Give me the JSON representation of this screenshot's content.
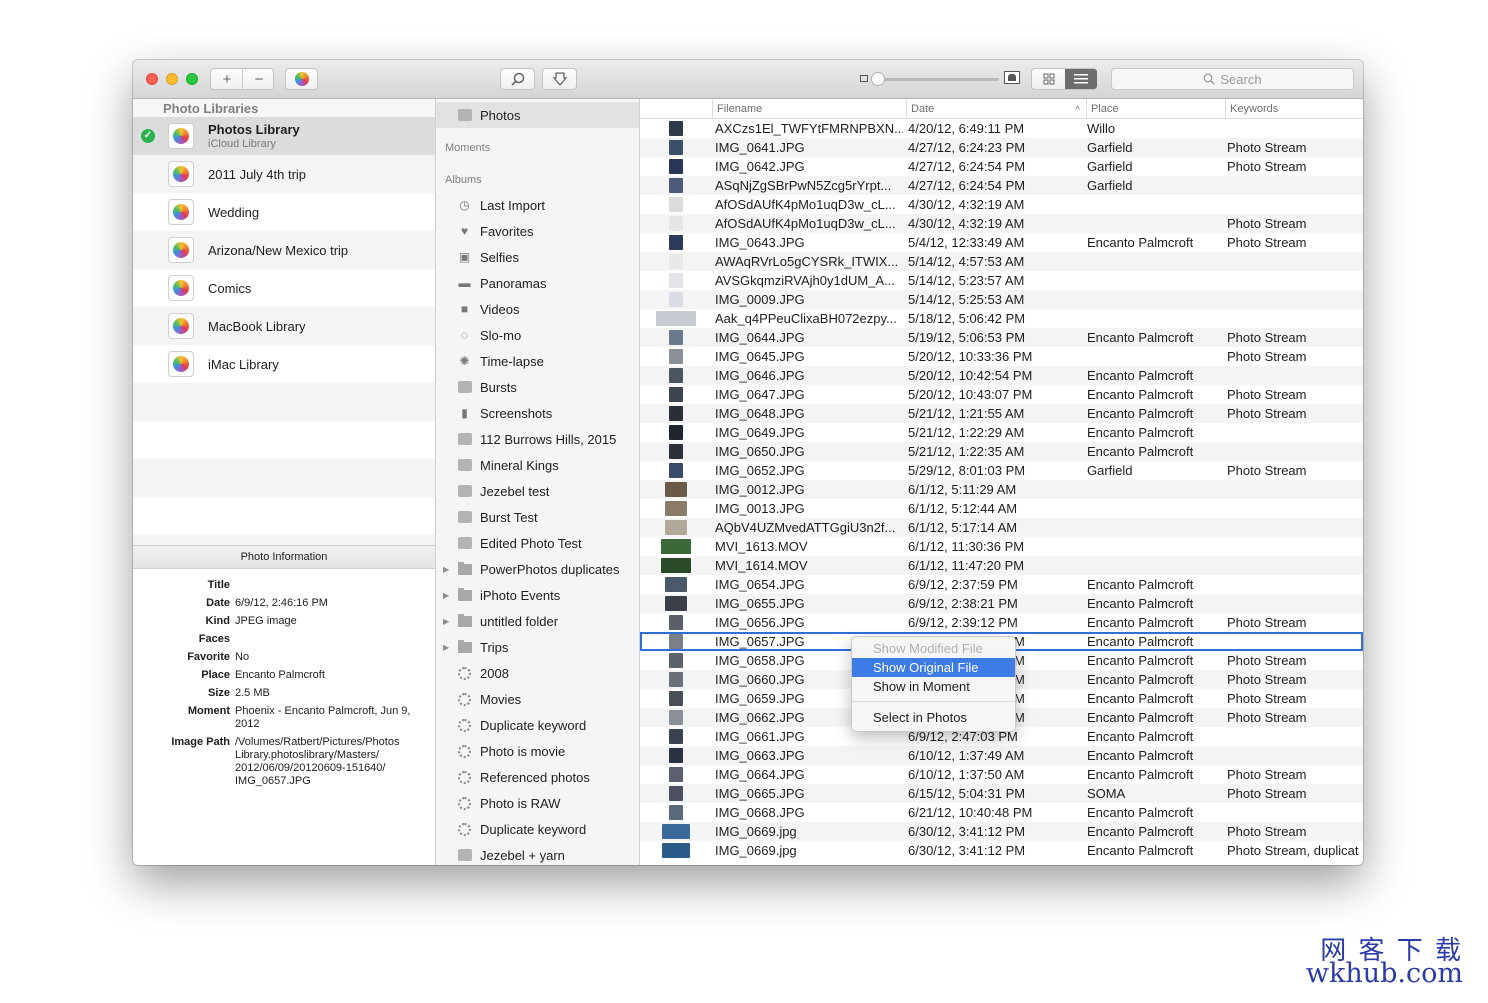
{
  "toolbar": {
    "add_label": "+",
    "remove_label": "−",
    "search_placeholder": "Search"
  },
  "libraries": {
    "header": "Photo Libraries",
    "items": [
      {
        "name": "Photos Library",
        "subtitle": "iCloud Library",
        "selected": true
      },
      {
        "name": "2011 July 4th trip"
      },
      {
        "name": "Wedding"
      },
      {
        "name": "Arizona/New Mexico trip"
      },
      {
        "name": "Comics"
      },
      {
        "name": "MacBook Library"
      },
      {
        "name": "iMac Library"
      }
    ]
  },
  "photo_info": {
    "header": "Photo Information",
    "fields": [
      {
        "label": "Title",
        "value": ""
      },
      {
        "label": "Date",
        "value": "6/9/12, 2:46:16 PM"
      },
      {
        "label": "Kind",
        "value": "JPEG image"
      },
      {
        "label": "Faces",
        "value": ""
      },
      {
        "label": "Favorite",
        "value": "No"
      },
      {
        "label": "Place",
        "value": "Encanto Palmcroft"
      },
      {
        "label": "Size",
        "value": "2.5 MB"
      },
      {
        "label": "Moment",
        "value": "Phoenix - Encanto Palmcroft, Jun 9, 2012"
      },
      {
        "label": "Image Path",
        "value": "/Volumes/Ratbert/Pictures/Photos Library.photoslibrary/Masters/ 2012/06/09/20120609-151640/ IMG_0657.JPG"
      }
    ]
  },
  "albums": {
    "top": "Photos",
    "moments_label": "Moments",
    "albums_label": "Albums",
    "items": [
      {
        "label": "Last Import",
        "icon": "clock-icon"
      },
      {
        "label": "Favorites",
        "icon": "heart-icon"
      },
      {
        "label": "Selfies",
        "icon": "camera-icon"
      },
      {
        "label": "Panoramas",
        "icon": "panorama-icon"
      },
      {
        "label": "Videos",
        "icon": "video-icon"
      },
      {
        "label": "Slo-mo",
        "icon": "slomo-icon"
      },
      {
        "label": "Time-lapse",
        "icon": "timelapse-icon"
      },
      {
        "label": "Bursts",
        "icon": "album-icon"
      },
      {
        "label": "Screenshots",
        "icon": "phone-icon"
      },
      {
        "label": "112 Burrows Hills, 2015",
        "icon": "album-icon"
      },
      {
        "label": "Mineral Kings",
        "icon": "album-icon"
      },
      {
        "label": "Jezebel test",
        "icon": "album-icon"
      },
      {
        "label": "Burst Test",
        "icon": "album-icon"
      },
      {
        "label": "Edited Photo Test",
        "icon": "album-icon"
      },
      {
        "label": "PowerPhotos duplicates",
        "icon": "folder-icon",
        "expandable": true
      },
      {
        "label": "iPhoto Events",
        "icon": "folder-icon",
        "expandable": true
      },
      {
        "label": "untitled folder",
        "icon": "folder-icon",
        "expandable": true
      },
      {
        "label": "Trips",
        "icon": "folder-icon",
        "expandable": true
      },
      {
        "label": "2008",
        "icon": "smart-album-icon"
      },
      {
        "label": "Movies",
        "icon": "smart-album-icon"
      },
      {
        "label": "Duplicate keyword",
        "icon": "smart-album-icon"
      },
      {
        "label": "Photo is movie",
        "icon": "smart-album-icon"
      },
      {
        "label": "Referenced photos",
        "icon": "smart-album-icon"
      },
      {
        "label": "Photo is RAW",
        "icon": "smart-album-icon"
      },
      {
        "label": "Duplicate keyword",
        "icon": "smart-album-icon"
      },
      {
        "label": "Jezebel + yarn",
        "icon": "album-icon"
      }
    ]
  },
  "table": {
    "columns": [
      "Filename",
      "Date",
      "Place",
      "Keywords"
    ],
    "sort_indicator": "^",
    "rows": [
      {
        "filename": "AXCzs1El_TWFYtFMRNPBXN...",
        "date": "4/20/12, 6:49:11 PM",
        "place": "Willo",
        "keywords": ""
      },
      {
        "filename": "IMG_0641.JPG",
        "date": "4/27/12, 6:24:23 PM",
        "place": "Garfield",
        "keywords": "Photo Stream"
      },
      {
        "filename": "IMG_0642.JPG",
        "date": "4/27/12, 6:24:54 PM",
        "place": "Garfield",
        "keywords": "Photo Stream"
      },
      {
        "filename": "ASqNjZgSBrPwN5Zcg5rYrpt...",
        "date": "4/27/12, 6:24:54 PM",
        "place": "Garfield",
        "keywords": ""
      },
      {
        "filename": "AfOSdAUfK4pMo1uqD3w_cL...",
        "date": "4/30/12, 4:32:19 AM",
        "place": "",
        "keywords": ""
      },
      {
        "filename": "AfOSdAUfK4pMo1uqD3w_cL...",
        "date": "4/30/12, 4:32:19 AM",
        "place": "",
        "keywords": "Photo Stream"
      },
      {
        "filename": "IMG_0643.JPG",
        "date": "5/4/12, 12:33:49 AM",
        "place": "Encanto Palmcroft",
        "keywords": "Photo Stream"
      },
      {
        "filename": "AWAqRVrLo5gCYSRk_ITWIX...",
        "date": "5/14/12, 4:57:53 AM",
        "place": "",
        "keywords": ""
      },
      {
        "filename": "AVSGkqmziRVAjh0y1dUM_A...",
        "date": "5/14/12, 5:23:57 AM",
        "place": "",
        "keywords": ""
      },
      {
        "filename": "IMG_0009.JPG",
        "date": "5/14/12, 5:25:53 AM",
        "place": "",
        "keywords": ""
      },
      {
        "filename": "Aak_q4PPeuClixaBH072ezpy...",
        "date": "5/18/12, 5:06:42 PM",
        "place": "",
        "keywords": ""
      },
      {
        "filename": "IMG_0644.JPG",
        "date": "5/19/12, 5:06:53 PM",
        "place": "Encanto Palmcroft",
        "keywords": "Photo Stream"
      },
      {
        "filename": "IMG_0645.JPG",
        "date": "5/20/12, 10:33:36 PM",
        "place": "",
        "keywords": "Photo Stream"
      },
      {
        "filename": "IMG_0646.JPG",
        "date": "5/20/12, 10:42:54 PM",
        "place": "Encanto Palmcroft",
        "keywords": ""
      },
      {
        "filename": "IMG_0647.JPG",
        "date": "5/20/12, 10:43:07 PM",
        "place": "Encanto Palmcroft",
        "keywords": "Photo Stream"
      },
      {
        "filename": "IMG_0648.JPG",
        "date": "5/21/12, 1:21:55 AM",
        "place": "Encanto Palmcroft",
        "keywords": "Photo Stream"
      },
      {
        "filename": "IMG_0649.JPG",
        "date": "5/21/12, 1:22:29 AM",
        "place": "Encanto Palmcroft",
        "keywords": ""
      },
      {
        "filename": "IMG_0650.JPG",
        "date": "5/21/12, 1:22:35 AM",
        "place": "Encanto Palmcroft",
        "keywords": ""
      },
      {
        "filename": "IMG_0652.JPG",
        "date": "5/29/12, 8:01:03 PM",
        "place": "Garfield",
        "keywords": "Photo Stream"
      },
      {
        "filename": "IMG_0012.JPG",
        "date": "6/1/12, 5:11:29 AM",
        "place": "",
        "keywords": ""
      },
      {
        "filename": "IMG_0013.JPG",
        "date": "6/1/12, 5:12:44 AM",
        "place": "",
        "keywords": ""
      },
      {
        "filename": "AQbV4UZMvedATTGgiU3n2f...",
        "date": "6/1/12, 5:17:14 AM",
        "place": "",
        "keywords": ""
      },
      {
        "filename": "MVI_1613.MOV",
        "date": "6/1/12, 11:30:36 PM",
        "place": "",
        "keywords": ""
      },
      {
        "filename": "MVI_1614.MOV",
        "date": "6/1/12, 11:47:20 PM",
        "place": "",
        "keywords": ""
      },
      {
        "filename": "IMG_0654.JPG",
        "date": "6/9/12, 2:37:59 PM",
        "place": "Encanto Palmcroft",
        "keywords": ""
      },
      {
        "filename": "IMG_0655.JPG",
        "date": "6/9/12, 2:38:21 PM",
        "place": "Encanto Palmcroft",
        "keywords": ""
      },
      {
        "filename": "IMG_0656.JPG",
        "date": "6/9/12, 2:39:12 PM",
        "place": "Encanto Palmcroft",
        "keywords": "Photo Stream"
      },
      {
        "filename": "IMG_0657.JPG",
        "date": "M",
        "place": "Encanto Palmcroft",
        "keywords": "",
        "selected": true
      },
      {
        "filename": "IMG_0658.JPG",
        "date": "M",
        "place": "Encanto Palmcroft",
        "keywords": "Photo Stream"
      },
      {
        "filename": "IMG_0660.JPG",
        "date": "M",
        "place": "Encanto Palmcroft",
        "keywords": "Photo Stream"
      },
      {
        "filename": "IMG_0659.JPG",
        "date": "M",
        "place": "Encanto Palmcroft",
        "keywords": "Photo Stream"
      },
      {
        "filename": "IMG_0662.JPG",
        "date": "M",
        "place": "Encanto Palmcroft",
        "keywords": "Photo Stream"
      },
      {
        "filename": "IMG_0661.JPG",
        "date": "6/9/12, 2:47:03 PM",
        "place": "Encanto Palmcroft",
        "keywords": ""
      },
      {
        "filename": "IMG_0663.JPG",
        "date": "6/10/12, 1:37:49 AM",
        "place": "Encanto Palmcroft",
        "keywords": ""
      },
      {
        "filename": "IMG_0664.JPG",
        "date": "6/10/12, 1:37:50 AM",
        "place": "Encanto Palmcroft",
        "keywords": "Photo Stream"
      },
      {
        "filename": "IMG_0665.JPG",
        "date": "6/15/12, 5:04:31 PM",
        "place": "SOMA",
        "keywords": "Photo Stream"
      },
      {
        "filename": "IMG_0668.JPG",
        "date": "6/21/12, 10:40:48 PM",
        "place": "Encanto Palmcroft",
        "keywords": ""
      },
      {
        "filename": "IMG_0669.jpg",
        "date": "6/30/12, 3:41:12 PM",
        "place": "Encanto Palmcroft",
        "keywords": "Photo Stream"
      },
      {
        "filename": "IMG_0669.jpg",
        "date": "6/30/12, 3:41:12 PM",
        "place": "Encanto Palmcroft",
        "keywords": "Photo Stream, duplicat"
      }
    ]
  },
  "context_menu": {
    "items": [
      "Show Modified File",
      "Show Original File",
      "Show in Moment",
      "Select in Photos"
    ]
  },
  "watermark": {
    "line1": "网 客 下 载",
    "line2": "wkhub.com"
  },
  "colors": {
    "selection_blue": "#2f6fd8",
    "menu_highlight": "#3d7ce4",
    "checkmark_green": "#2bb24c",
    "watermark": "#2b3ba8"
  }
}
